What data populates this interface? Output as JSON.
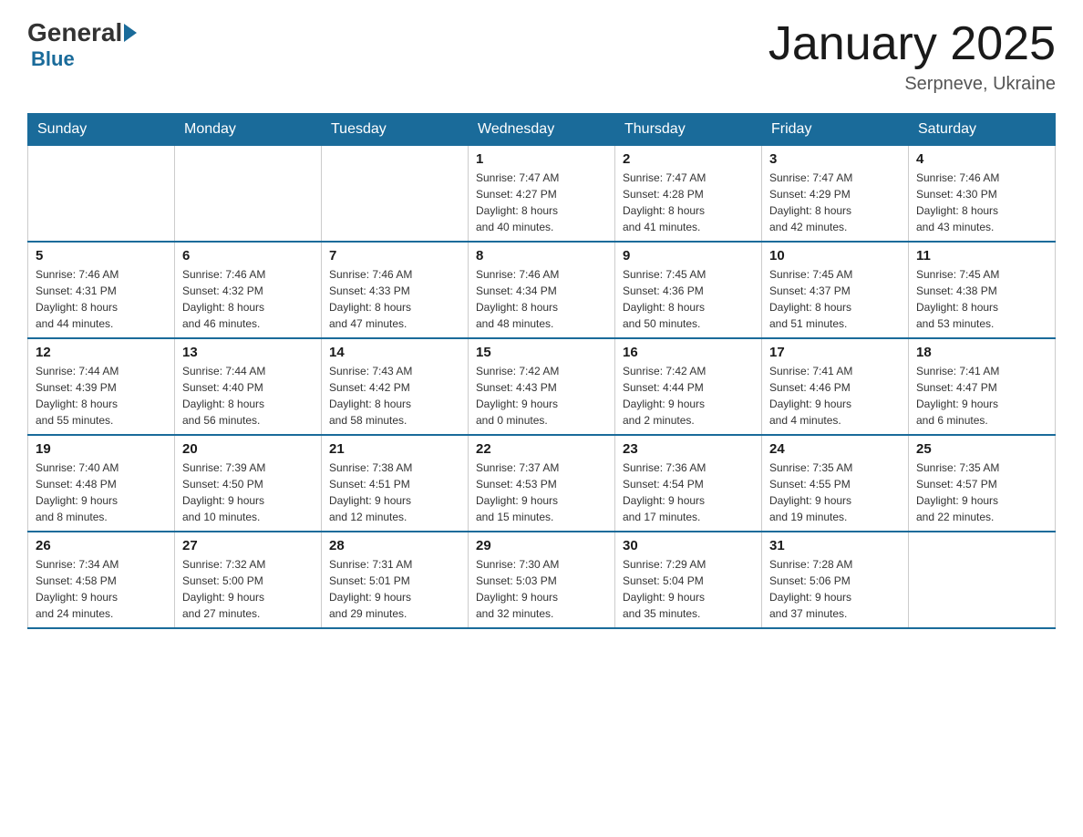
{
  "logo": {
    "general": "General",
    "blue": "Blue"
  },
  "header": {
    "title": "January 2025",
    "subtitle": "Serpneve, Ukraine"
  },
  "days_of_week": [
    "Sunday",
    "Monday",
    "Tuesday",
    "Wednesday",
    "Thursday",
    "Friday",
    "Saturday"
  ],
  "weeks": [
    [
      {
        "day": "",
        "info": ""
      },
      {
        "day": "",
        "info": ""
      },
      {
        "day": "",
        "info": ""
      },
      {
        "day": "1",
        "info": "Sunrise: 7:47 AM\nSunset: 4:27 PM\nDaylight: 8 hours\nand 40 minutes."
      },
      {
        "day": "2",
        "info": "Sunrise: 7:47 AM\nSunset: 4:28 PM\nDaylight: 8 hours\nand 41 minutes."
      },
      {
        "day": "3",
        "info": "Sunrise: 7:47 AM\nSunset: 4:29 PM\nDaylight: 8 hours\nand 42 minutes."
      },
      {
        "day": "4",
        "info": "Sunrise: 7:46 AM\nSunset: 4:30 PM\nDaylight: 8 hours\nand 43 minutes."
      }
    ],
    [
      {
        "day": "5",
        "info": "Sunrise: 7:46 AM\nSunset: 4:31 PM\nDaylight: 8 hours\nand 44 minutes."
      },
      {
        "day": "6",
        "info": "Sunrise: 7:46 AM\nSunset: 4:32 PM\nDaylight: 8 hours\nand 46 minutes."
      },
      {
        "day": "7",
        "info": "Sunrise: 7:46 AM\nSunset: 4:33 PM\nDaylight: 8 hours\nand 47 minutes."
      },
      {
        "day": "8",
        "info": "Sunrise: 7:46 AM\nSunset: 4:34 PM\nDaylight: 8 hours\nand 48 minutes."
      },
      {
        "day": "9",
        "info": "Sunrise: 7:45 AM\nSunset: 4:36 PM\nDaylight: 8 hours\nand 50 minutes."
      },
      {
        "day": "10",
        "info": "Sunrise: 7:45 AM\nSunset: 4:37 PM\nDaylight: 8 hours\nand 51 minutes."
      },
      {
        "day": "11",
        "info": "Sunrise: 7:45 AM\nSunset: 4:38 PM\nDaylight: 8 hours\nand 53 minutes."
      }
    ],
    [
      {
        "day": "12",
        "info": "Sunrise: 7:44 AM\nSunset: 4:39 PM\nDaylight: 8 hours\nand 55 minutes."
      },
      {
        "day": "13",
        "info": "Sunrise: 7:44 AM\nSunset: 4:40 PM\nDaylight: 8 hours\nand 56 minutes."
      },
      {
        "day": "14",
        "info": "Sunrise: 7:43 AM\nSunset: 4:42 PM\nDaylight: 8 hours\nand 58 minutes."
      },
      {
        "day": "15",
        "info": "Sunrise: 7:42 AM\nSunset: 4:43 PM\nDaylight: 9 hours\nand 0 minutes."
      },
      {
        "day": "16",
        "info": "Sunrise: 7:42 AM\nSunset: 4:44 PM\nDaylight: 9 hours\nand 2 minutes."
      },
      {
        "day": "17",
        "info": "Sunrise: 7:41 AM\nSunset: 4:46 PM\nDaylight: 9 hours\nand 4 minutes."
      },
      {
        "day": "18",
        "info": "Sunrise: 7:41 AM\nSunset: 4:47 PM\nDaylight: 9 hours\nand 6 minutes."
      }
    ],
    [
      {
        "day": "19",
        "info": "Sunrise: 7:40 AM\nSunset: 4:48 PM\nDaylight: 9 hours\nand 8 minutes."
      },
      {
        "day": "20",
        "info": "Sunrise: 7:39 AM\nSunset: 4:50 PM\nDaylight: 9 hours\nand 10 minutes."
      },
      {
        "day": "21",
        "info": "Sunrise: 7:38 AM\nSunset: 4:51 PM\nDaylight: 9 hours\nand 12 minutes."
      },
      {
        "day": "22",
        "info": "Sunrise: 7:37 AM\nSunset: 4:53 PM\nDaylight: 9 hours\nand 15 minutes."
      },
      {
        "day": "23",
        "info": "Sunrise: 7:36 AM\nSunset: 4:54 PM\nDaylight: 9 hours\nand 17 minutes."
      },
      {
        "day": "24",
        "info": "Sunrise: 7:35 AM\nSunset: 4:55 PM\nDaylight: 9 hours\nand 19 minutes."
      },
      {
        "day": "25",
        "info": "Sunrise: 7:35 AM\nSunset: 4:57 PM\nDaylight: 9 hours\nand 22 minutes."
      }
    ],
    [
      {
        "day": "26",
        "info": "Sunrise: 7:34 AM\nSunset: 4:58 PM\nDaylight: 9 hours\nand 24 minutes."
      },
      {
        "day": "27",
        "info": "Sunrise: 7:32 AM\nSunset: 5:00 PM\nDaylight: 9 hours\nand 27 minutes."
      },
      {
        "day": "28",
        "info": "Sunrise: 7:31 AM\nSunset: 5:01 PM\nDaylight: 9 hours\nand 29 minutes."
      },
      {
        "day": "29",
        "info": "Sunrise: 7:30 AM\nSunset: 5:03 PM\nDaylight: 9 hours\nand 32 minutes."
      },
      {
        "day": "30",
        "info": "Sunrise: 7:29 AM\nSunset: 5:04 PM\nDaylight: 9 hours\nand 35 minutes."
      },
      {
        "day": "31",
        "info": "Sunrise: 7:28 AM\nSunset: 5:06 PM\nDaylight: 9 hours\nand 37 minutes."
      },
      {
        "day": "",
        "info": ""
      }
    ]
  ]
}
